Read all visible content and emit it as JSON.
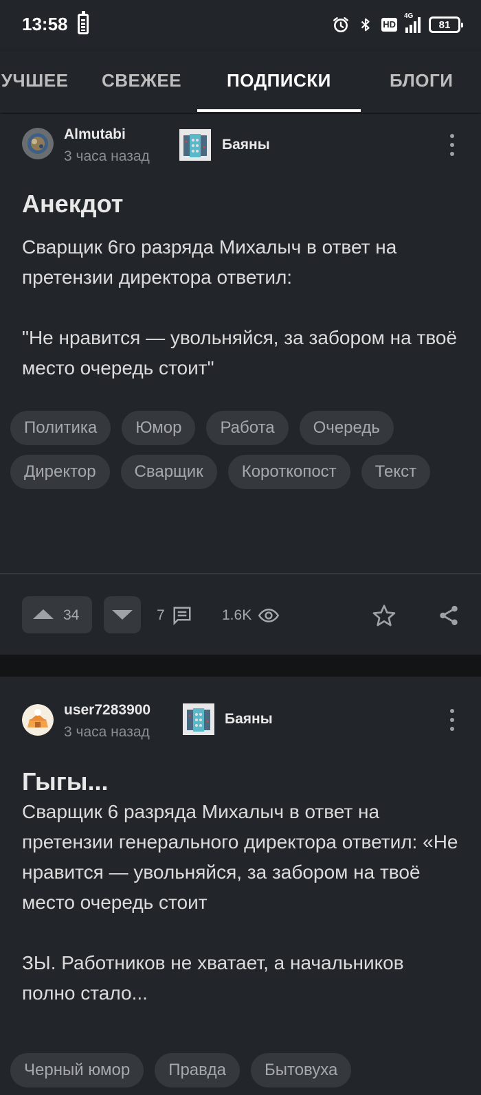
{
  "status_bar": {
    "time": "13:58",
    "network": "4G",
    "hd": "HD",
    "battery": "81",
    "icons": [
      "battery-saver-icon",
      "alarm-icon",
      "bluetooth-icon",
      "hd-icon",
      "signal-icon",
      "battery-icon"
    ]
  },
  "tabs": [
    {
      "label": "ЛУЧШЕЕ"
    },
    {
      "label": "СВЕЖЕЕ"
    },
    {
      "label": "ПОДПИСКИ",
      "active": true
    },
    {
      "label": "БЛОГИ"
    }
  ],
  "posts": [
    {
      "author": "Almutabi",
      "time": "3 часа назад",
      "community": "Баяны",
      "title": "Анекдот",
      "body": "Сварщик 6го разряда Михалыч в ответ на претензии директора ответил:\n\n\"Не нравится — увольняйся, за забором на твоё место очередь стоит\"",
      "tags": [
        "Политика",
        "Юмор",
        "Работа",
        "Очередь",
        "Директор",
        "Сварщик",
        "Короткопост",
        "Текст"
      ],
      "rating": "34",
      "comments": "7",
      "views": "1.6K"
    },
    {
      "author": "user7283900",
      "time": "3 часа назад",
      "community": "Баяны",
      "title": "Гыгы...",
      "body": "Сварщик 6 разряда Михалыч в ответ на претензии генерального директора ответил: «Не нравится — увольняйся, за забором на твоё место очередь стоит\n\nЗЫ. Работников не хватает, а начальников полно стало...",
      "tags": [
        "Черный юмор",
        "Правда",
        "Бытовуха"
      ]
    }
  ],
  "colors": {
    "background": "#222529",
    "chip": "#35383c",
    "muted_text": "#8a8d91",
    "separator": "#131416"
  }
}
